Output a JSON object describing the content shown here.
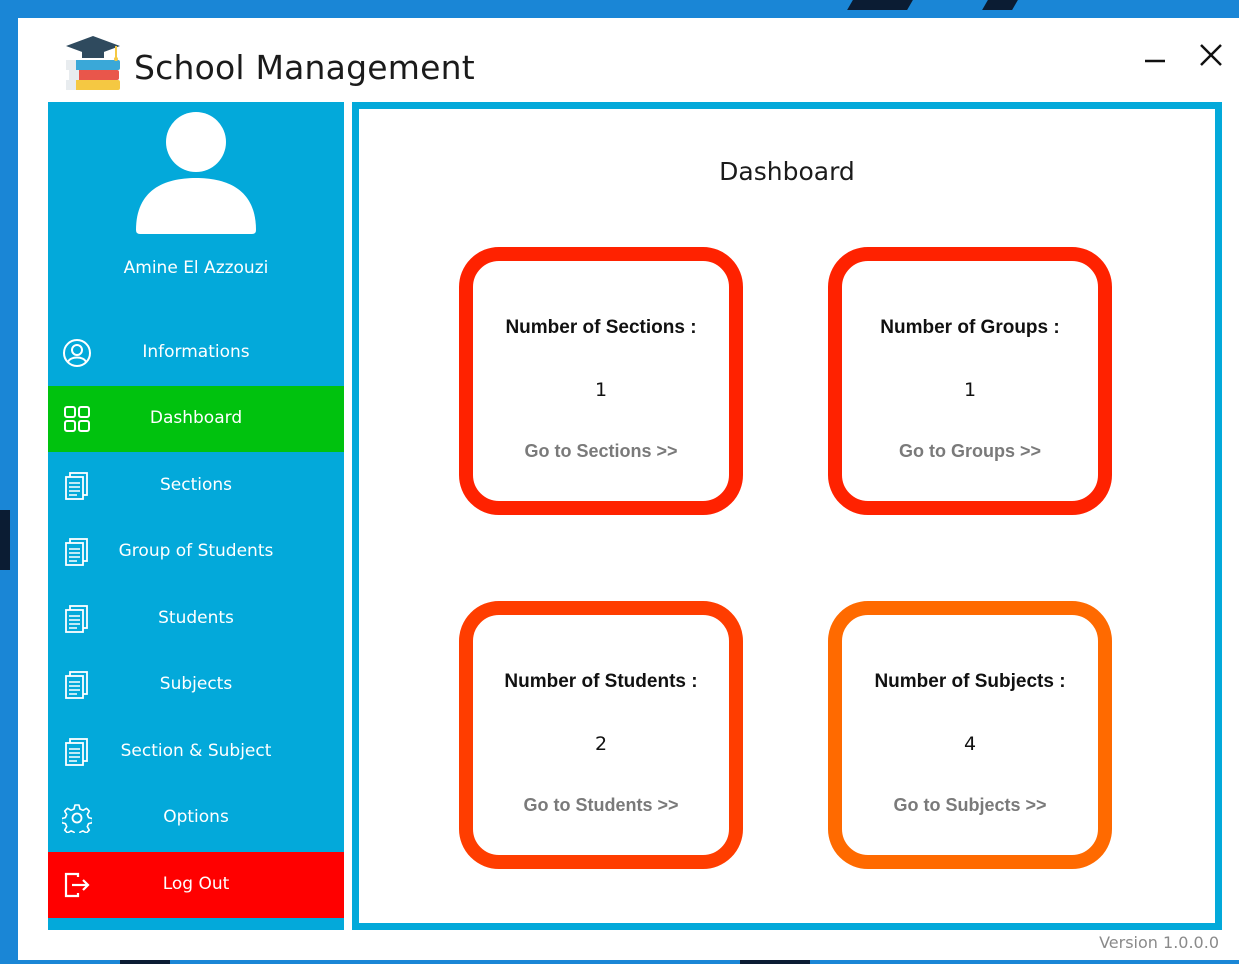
{
  "window": {
    "title": "School Management",
    "minimize_icon": "minimize-icon",
    "close_icon": "close-icon"
  },
  "user": {
    "name": "Amine El Azzouzi",
    "avatar_icon": "user-avatar-icon"
  },
  "sidebar": {
    "items": [
      {
        "label": "Informations",
        "icon": "user-circle-icon"
      },
      {
        "label": "Dashboard",
        "icon": "grid-icon",
        "active": true
      },
      {
        "label": "Sections",
        "icon": "document-icon"
      },
      {
        "label": "Group of Students",
        "icon": "document-icon"
      },
      {
        "label": "Students",
        "icon": "document-icon"
      },
      {
        "label": "Subjects",
        "icon": "document-icon"
      },
      {
        "label": "Section & Subject",
        "icon": "document-icon"
      },
      {
        "label": "Options",
        "icon": "gear-icon"
      },
      {
        "label": "Log Out",
        "icon": "logout-icon"
      }
    ]
  },
  "dashboard": {
    "title": "Dashboard",
    "cards": [
      {
        "label": "Number of Sections :",
        "value": "1",
        "link": "Go to Sections >>",
        "color": "#ff2200"
      },
      {
        "label": "Number of Groups :",
        "value": "1",
        "link": "Go to Groups >>",
        "color": "#ff2200"
      },
      {
        "label": "Number of Students :",
        "value": "2",
        "link": "Go to Students >>",
        "color": "#ff3d00"
      },
      {
        "label": "Number of Subjects :",
        "value": "4",
        "link": "Go to Subjects >>",
        "color": "#ff6a00"
      }
    ]
  },
  "footer": {
    "version": "Version 1.0.0.0"
  },
  "colors": {
    "sidebar": "#03a9da",
    "active": "#00c20e",
    "logout": "#ff0000"
  }
}
